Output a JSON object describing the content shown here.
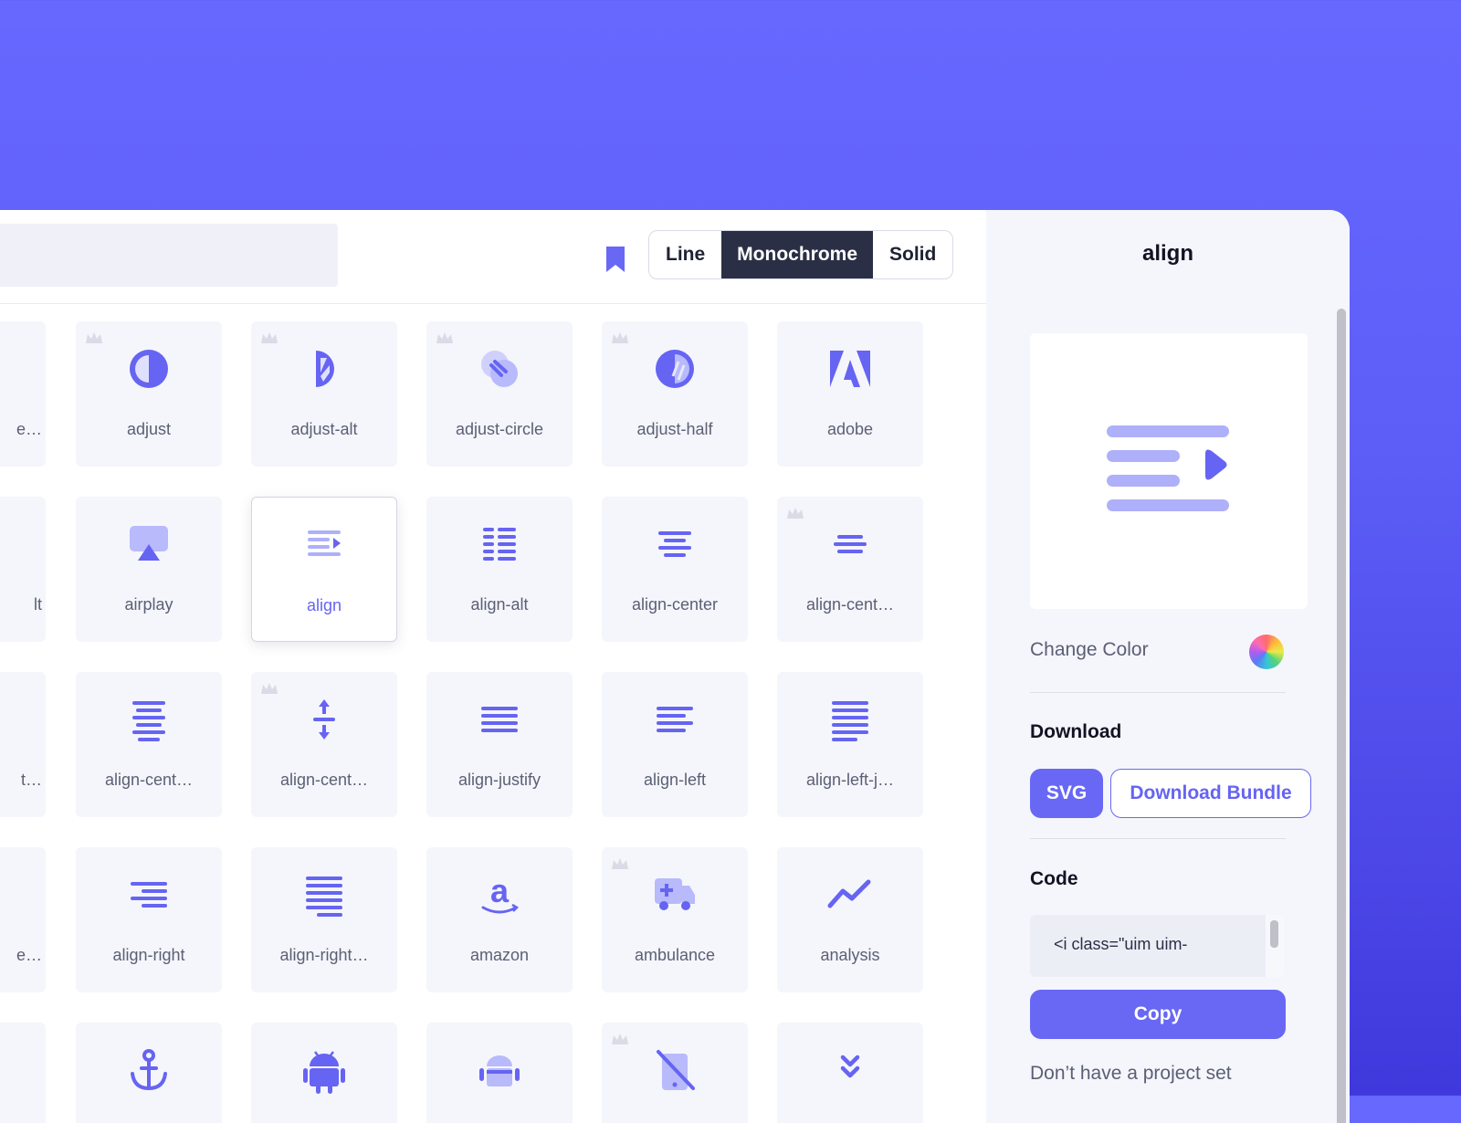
{
  "toolbar": {
    "search_placeholder": "",
    "style_options": [
      "Line",
      "Monochrome",
      "Solid"
    ],
    "active_style": "Monochrome"
  },
  "grid": {
    "rows": [
      [
        "e…",
        "adjust",
        "adjust-alt",
        "adjust-circle",
        "adjust-half",
        "adobe"
      ],
      [
        "lt",
        "airplay",
        "align",
        "align-alt",
        "align-center",
        "align-cent…"
      ],
      [
        "t…",
        "align-cent…",
        "align-cent…",
        "align-justify",
        "align-left",
        "align-left-j…"
      ],
      [
        "e…",
        "align-right",
        "align-right…",
        "amazon",
        "ambulance",
        "analysis"
      ],
      [
        "",
        "",
        "",
        "",
        "",
        ""
      ]
    ],
    "icons": [
      [
        "",
        "adjust-icon",
        "adjust-alt-icon",
        "adjust-circle-icon",
        "adjust-half-icon",
        "adobe-icon"
      ],
      [
        "",
        "airplay-icon",
        "align-icon",
        "align-alt-icon",
        "align-center-icon",
        "align-center-alt-icon"
      ],
      [
        "",
        "align-center-justify-icon",
        "align-center-h-icon",
        "align-justify-icon",
        "align-left-icon",
        "align-left-justify-icon"
      ],
      [
        "",
        "align-right-icon",
        "align-right-justify-icon",
        "amazon-icon",
        "ambulance-icon",
        "analysis-icon"
      ],
      [
        "",
        "anchor-icon",
        "android-icon",
        "android-alt-icon",
        "no-mobile-icon",
        "angle-double-down-icon"
      ]
    ],
    "premium": [
      [
        false,
        true,
        true,
        true,
        true,
        false
      ],
      [
        false,
        false,
        false,
        false,
        false,
        true
      ],
      [
        false,
        false,
        true,
        false,
        false,
        false
      ],
      [
        false,
        false,
        false,
        false,
        true,
        false
      ],
      [
        false,
        false,
        false,
        false,
        true,
        false
      ]
    ],
    "selected": "align"
  },
  "panel": {
    "title": "align",
    "change_color_label": "Change Color",
    "download_title": "Download",
    "svg_label": "SVG",
    "bundle_label": "Download Bundle",
    "code_title": "Code",
    "code_snippet": "<i class=\"uim uim-",
    "copy_label": "Copy",
    "footnote": "Don’t have a project set"
  },
  "colors": {
    "accent": "#6868f5",
    "icon_light": "#aeb0fa",
    "icon_dark": "#6664f2",
    "crown": "#d9dbe6",
    "toggle_active": "#2b2f45"
  }
}
